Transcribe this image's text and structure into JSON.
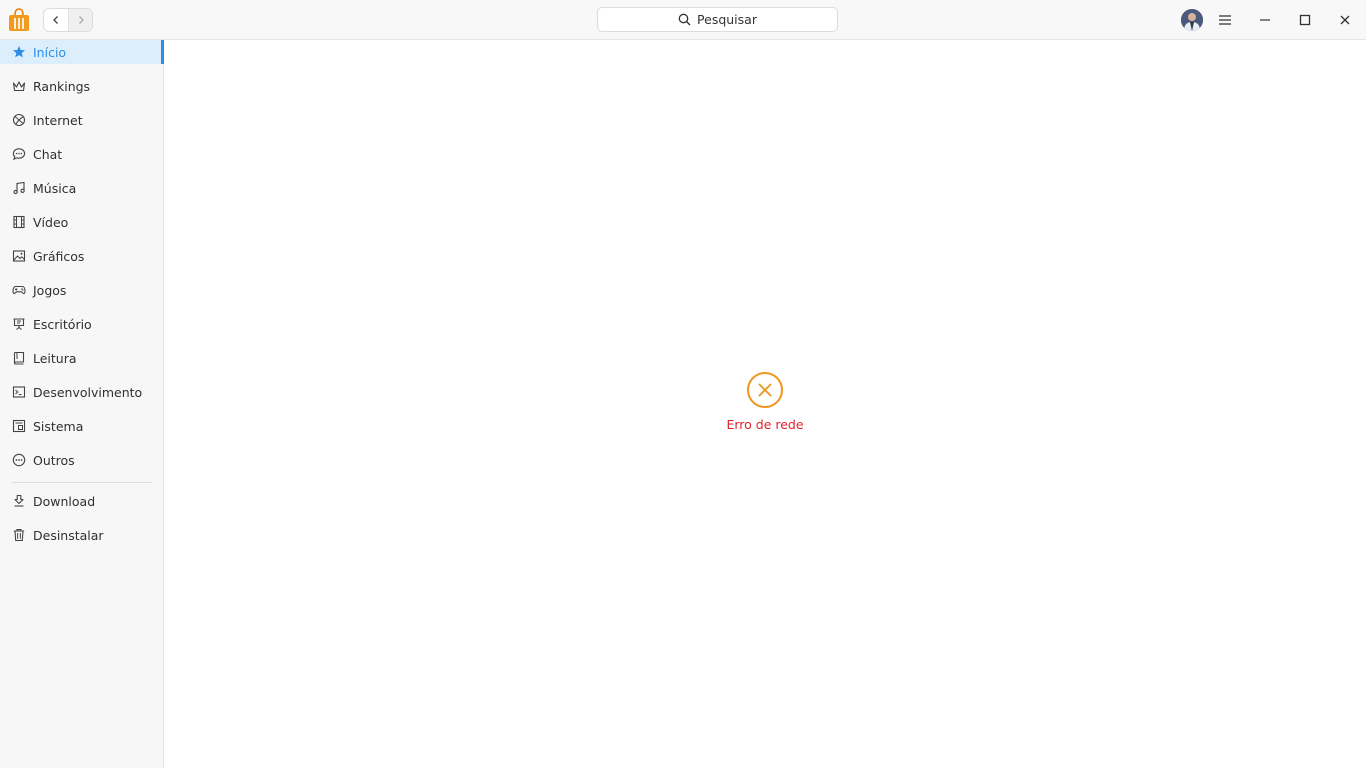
{
  "search": {
    "label": "Pesquisar"
  },
  "sidebar": {
    "items": [
      {
        "label": "Início",
        "icon": "star-icon",
        "active": true
      },
      {
        "label": "Rankings",
        "icon": "crown-icon"
      },
      {
        "label": "Internet",
        "icon": "globe-icon"
      },
      {
        "label": "Chat",
        "icon": "chat-icon"
      },
      {
        "label": "Música",
        "icon": "music-icon"
      },
      {
        "label": "Vídeo",
        "icon": "film-icon"
      },
      {
        "label": "Gráficos",
        "icon": "image-icon"
      },
      {
        "label": "Jogos",
        "icon": "gamepad-icon"
      },
      {
        "label": "Escritório",
        "icon": "presentation-icon"
      },
      {
        "label": "Leitura",
        "icon": "book-icon"
      },
      {
        "label": "Desenvolvimento",
        "icon": "terminal-icon"
      },
      {
        "label": "Sistema",
        "icon": "system-icon"
      },
      {
        "label": "Outros",
        "icon": "more-icon"
      }
    ],
    "bottom_items": [
      {
        "label": "Download",
        "icon": "download-icon"
      },
      {
        "label": "Desinstalar",
        "icon": "trash-icon"
      }
    ]
  },
  "main": {
    "error_message": "Erro de rede",
    "error_icon": "close-circle-icon"
  },
  "colors": {
    "accent": "#2b8fe8",
    "error_text": "#e0232b",
    "error_icon": "#f0941f"
  }
}
